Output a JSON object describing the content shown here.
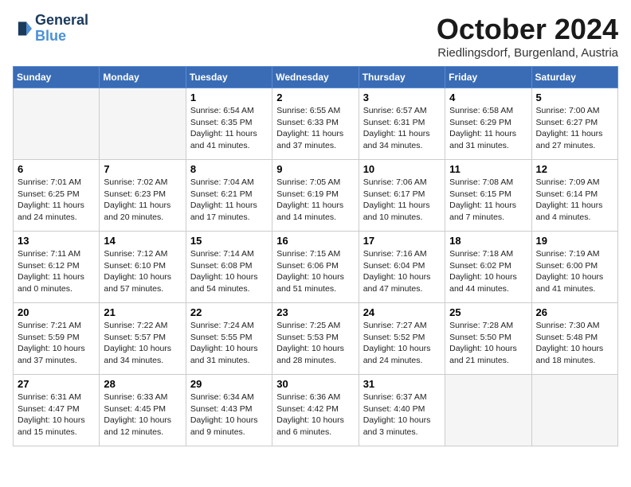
{
  "logo": {
    "line1": "General",
    "line2": "Blue"
  },
  "title": "October 2024",
  "location": "Riedlingsdorf, Burgenland, Austria",
  "weekdays": [
    "Sunday",
    "Monday",
    "Tuesday",
    "Wednesday",
    "Thursday",
    "Friday",
    "Saturday"
  ],
  "weeks": [
    [
      {
        "day": "",
        "sunrise": "",
        "sunset": "",
        "daylight": ""
      },
      {
        "day": "",
        "sunrise": "",
        "sunset": "",
        "daylight": ""
      },
      {
        "day": "1",
        "sunrise": "Sunrise: 6:54 AM",
        "sunset": "Sunset: 6:35 PM",
        "daylight": "Daylight: 11 hours and 41 minutes."
      },
      {
        "day": "2",
        "sunrise": "Sunrise: 6:55 AM",
        "sunset": "Sunset: 6:33 PM",
        "daylight": "Daylight: 11 hours and 37 minutes."
      },
      {
        "day": "3",
        "sunrise": "Sunrise: 6:57 AM",
        "sunset": "Sunset: 6:31 PM",
        "daylight": "Daylight: 11 hours and 34 minutes."
      },
      {
        "day": "4",
        "sunrise": "Sunrise: 6:58 AM",
        "sunset": "Sunset: 6:29 PM",
        "daylight": "Daylight: 11 hours and 31 minutes."
      },
      {
        "day": "5",
        "sunrise": "Sunrise: 7:00 AM",
        "sunset": "Sunset: 6:27 PM",
        "daylight": "Daylight: 11 hours and 27 minutes."
      }
    ],
    [
      {
        "day": "6",
        "sunrise": "Sunrise: 7:01 AM",
        "sunset": "Sunset: 6:25 PM",
        "daylight": "Daylight: 11 hours and 24 minutes."
      },
      {
        "day": "7",
        "sunrise": "Sunrise: 7:02 AM",
        "sunset": "Sunset: 6:23 PM",
        "daylight": "Daylight: 11 hours and 20 minutes."
      },
      {
        "day": "8",
        "sunrise": "Sunrise: 7:04 AM",
        "sunset": "Sunset: 6:21 PM",
        "daylight": "Daylight: 11 hours and 17 minutes."
      },
      {
        "day": "9",
        "sunrise": "Sunrise: 7:05 AM",
        "sunset": "Sunset: 6:19 PM",
        "daylight": "Daylight: 11 hours and 14 minutes."
      },
      {
        "day": "10",
        "sunrise": "Sunrise: 7:06 AM",
        "sunset": "Sunset: 6:17 PM",
        "daylight": "Daylight: 11 hours and 10 minutes."
      },
      {
        "day": "11",
        "sunrise": "Sunrise: 7:08 AM",
        "sunset": "Sunset: 6:15 PM",
        "daylight": "Daylight: 11 hours and 7 minutes."
      },
      {
        "day": "12",
        "sunrise": "Sunrise: 7:09 AM",
        "sunset": "Sunset: 6:14 PM",
        "daylight": "Daylight: 11 hours and 4 minutes."
      }
    ],
    [
      {
        "day": "13",
        "sunrise": "Sunrise: 7:11 AM",
        "sunset": "Sunset: 6:12 PM",
        "daylight": "Daylight: 11 hours and 0 minutes."
      },
      {
        "day": "14",
        "sunrise": "Sunrise: 7:12 AM",
        "sunset": "Sunset: 6:10 PM",
        "daylight": "Daylight: 10 hours and 57 minutes."
      },
      {
        "day": "15",
        "sunrise": "Sunrise: 7:14 AM",
        "sunset": "Sunset: 6:08 PM",
        "daylight": "Daylight: 10 hours and 54 minutes."
      },
      {
        "day": "16",
        "sunrise": "Sunrise: 7:15 AM",
        "sunset": "Sunset: 6:06 PM",
        "daylight": "Daylight: 10 hours and 51 minutes."
      },
      {
        "day": "17",
        "sunrise": "Sunrise: 7:16 AM",
        "sunset": "Sunset: 6:04 PM",
        "daylight": "Daylight: 10 hours and 47 minutes."
      },
      {
        "day": "18",
        "sunrise": "Sunrise: 7:18 AM",
        "sunset": "Sunset: 6:02 PM",
        "daylight": "Daylight: 10 hours and 44 minutes."
      },
      {
        "day": "19",
        "sunrise": "Sunrise: 7:19 AM",
        "sunset": "Sunset: 6:00 PM",
        "daylight": "Daylight: 10 hours and 41 minutes."
      }
    ],
    [
      {
        "day": "20",
        "sunrise": "Sunrise: 7:21 AM",
        "sunset": "Sunset: 5:59 PM",
        "daylight": "Daylight: 10 hours and 37 minutes."
      },
      {
        "day": "21",
        "sunrise": "Sunrise: 7:22 AM",
        "sunset": "Sunset: 5:57 PM",
        "daylight": "Daylight: 10 hours and 34 minutes."
      },
      {
        "day": "22",
        "sunrise": "Sunrise: 7:24 AM",
        "sunset": "Sunset: 5:55 PM",
        "daylight": "Daylight: 10 hours and 31 minutes."
      },
      {
        "day": "23",
        "sunrise": "Sunrise: 7:25 AM",
        "sunset": "Sunset: 5:53 PM",
        "daylight": "Daylight: 10 hours and 28 minutes."
      },
      {
        "day": "24",
        "sunrise": "Sunrise: 7:27 AM",
        "sunset": "Sunset: 5:52 PM",
        "daylight": "Daylight: 10 hours and 24 minutes."
      },
      {
        "day": "25",
        "sunrise": "Sunrise: 7:28 AM",
        "sunset": "Sunset: 5:50 PM",
        "daylight": "Daylight: 10 hours and 21 minutes."
      },
      {
        "day": "26",
        "sunrise": "Sunrise: 7:30 AM",
        "sunset": "Sunset: 5:48 PM",
        "daylight": "Daylight: 10 hours and 18 minutes."
      }
    ],
    [
      {
        "day": "27",
        "sunrise": "Sunrise: 6:31 AM",
        "sunset": "Sunset: 4:47 PM",
        "daylight": "Daylight: 10 hours and 15 minutes."
      },
      {
        "day": "28",
        "sunrise": "Sunrise: 6:33 AM",
        "sunset": "Sunset: 4:45 PM",
        "daylight": "Daylight: 10 hours and 12 minutes."
      },
      {
        "day": "29",
        "sunrise": "Sunrise: 6:34 AM",
        "sunset": "Sunset: 4:43 PM",
        "daylight": "Daylight: 10 hours and 9 minutes."
      },
      {
        "day": "30",
        "sunrise": "Sunrise: 6:36 AM",
        "sunset": "Sunset: 4:42 PM",
        "daylight": "Daylight: 10 hours and 6 minutes."
      },
      {
        "day": "31",
        "sunrise": "Sunrise: 6:37 AM",
        "sunset": "Sunset: 4:40 PM",
        "daylight": "Daylight: 10 hours and 3 minutes."
      },
      {
        "day": "",
        "sunrise": "",
        "sunset": "",
        "daylight": ""
      },
      {
        "day": "",
        "sunrise": "",
        "sunset": "",
        "daylight": ""
      }
    ]
  ]
}
